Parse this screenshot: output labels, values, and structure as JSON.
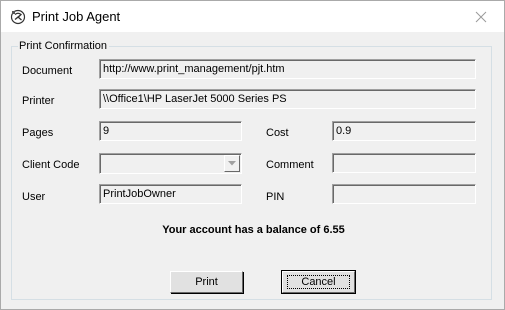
{
  "window": {
    "title": "Print Job Agent"
  },
  "group": {
    "legend": "Print Confirmation"
  },
  "fields": {
    "document": {
      "label": "Document",
      "value": "http://www.print_management/pjt.htm"
    },
    "printer": {
      "label": "Printer",
      "value": "\\\\Office1\\HP LaserJet 5000 Series PS"
    },
    "pages": {
      "label": "Pages",
      "value": "9"
    },
    "cost": {
      "label": "Cost",
      "value": "0.9"
    },
    "client_code": {
      "label": "Client Code",
      "value": ""
    },
    "comment": {
      "label": "Comment",
      "value": ""
    },
    "user": {
      "label": "User",
      "value": "PrintJobOwner"
    },
    "pin": {
      "label": "PIN",
      "value": ""
    }
  },
  "message": {
    "balance": "Your account has a balance of 6.55"
  },
  "buttons": {
    "print": "Print",
    "cancel": "Cancel"
  },
  "icons": {
    "app": "printer-agent-icon",
    "close": "close-icon",
    "dropdown": "chevron-down-icon"
  }
}
